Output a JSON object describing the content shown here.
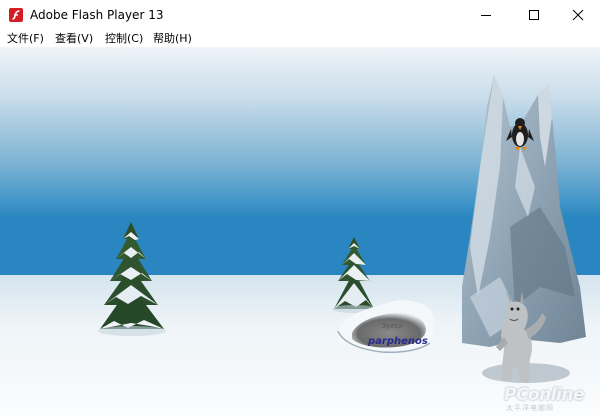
{
  "window": {
    "title": "Adobe Flash Player 13",
    "icon": "flash-player-icon",
    "controls": [
      "minimize-icon",
      "maximize-icon",
      "close-icon"
    ]
  },
  "menu": {
    "items": [
      {
        "label": "文件(F)"
      },
      {
        "label": "查看(V)"
      },
      {
        "label": "控制(C)"
      },
      {
        "label": "帮助(H)"
      }
    ]
  },
  "game": {
    "rock_caption": "Зуеск",
    "rock_label": "parphenos",
    "objects": [
      "pine-tree",
      "pine-tree",
      "ice-peak",
      "penguin",
      "yeti",
      "snow-rock"
    ]
  },
  "watermark": {
    "brand": "PConline",
    "sub": "太平洋电脑网"
  },
  "colors": {
    "sky_top": "#dceaf4",
    "sky_bottom": "#2a86c0",
    "snow": "#f4f8fb",
    "flash_red": "#d41e24",
    "label_blue": "#262a8c"
  }
}
